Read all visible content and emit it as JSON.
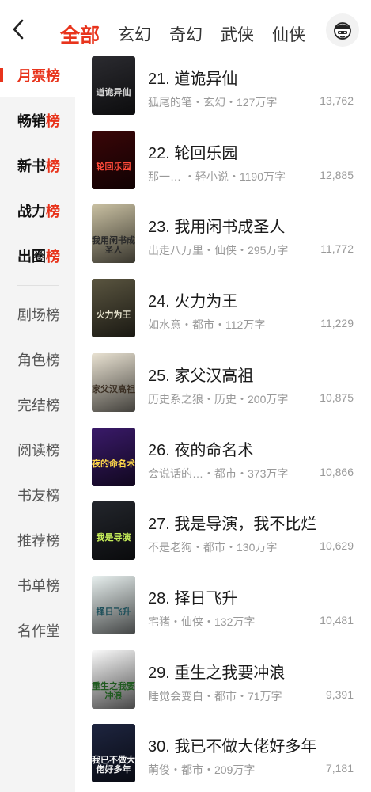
{
  "header": {
    "tabs": [
      "全部",
      "玄幻",
      "奇幻",
      "武侠",
      "仙侠"
    ],
    "active_tab": 0
  },
  "sidebar": {
    "items": [
      {
        "label_a": "月票",
        "label_b": "榜"
      },
      {
        "label_a": "畅销",
        "label_b": "榜"
      },
      {
        "label_a": "新书",
        "label_b": "榜"
      },
      {
        "label_a": "战力",
        "label_b": "榜"
      },
      {
        "label_a": "出圈",
        "label_b": "榜"
      },
      {
        "label_a": "剧场榜",
        "label_b": ""
      },
      {
        "label_a": "角色榜",
        "label_b": ""
      },
      {
        "label_a": "完结榜",
        "label_b": ""
      },
      {
        "label_a": "阅读榜",
        "label_b": ""
      },
      {
        "label_a": "书友榜",
        "label_b": ""
      },
      {
        "label_a": "推荐榜",
        "label_b": ""
      },
      {
        "label_a": "书单榜",
        "label_b": ""
      },
      {
        "label_a": "名作堂",
        "label_b": ""
      }
    ]
  },
  "books": [
    {
      "title": "21. 道诡异仙",
      "meta": "狐尾的笔・玄幻・127万字",
      "votes": "13,762",
      "cover_text": "道诡异仙",
      "cover_bg": "#2b2b30",
      "cover_fg": "#d8d8d8"
    },
    {
      "title": "22. 轮回乐园",
      "meta": "那一…   ・轻小说・1190万字",
      "votes": "12,885",
      "cover_text": "轮回乐园",
      "cover_bg": "#3a0608",
      "cover_fg": "#ff4a3a"
    },
    {
      "title": "23. 我用闲书成圣人",
      "meta": "出走八万里・仙侠・295万字",
      "votes": "11,772",
      "cover_text": "我用闲书成圣人",
      "cover_bg": "#c9c0a2",
      "cover_fg": "#2a2a2a"
    },
    {
      "title": "24. 火力为王",
      "meta": "如水意・都市・112万字",
      "votes": "11,229",
      "cover_text": "火力为王",
      "cover_bg": "#5a5540",
      "cover_fg": "#e8e4cf"
    },
    {
      "title": "25. 家父汉高祖",
      "meta": "历史系之狼・历史・200万字",
      "votes": "10,875",
      "cover_text": "家父汉高祖",
      "cover_bg": "#e9e2d2",
      "cover_fg": "#3a2e22"
    },
    {
      "title": "26. 夜的命名术",
      "meta": "会说话的…・都市・373万字",
      "votes": "10,866",
      "cover_text": "夜的命名术",
      "cover_bg": "#3a1a6a",
      "cover_fg": "#ffd84a"
    },
    {
      "title": "27. 我是导演，我不比烂",
      "meta": "不是老狗・都市・130万字",
      "votes": "10,629",
      "cover_text": "我是导演",
      "cover_bg": "#23262c",
      "cover_fg": "#c8f05a"
    },
    {
      "title": "28. 择日飞升",
      "meta": "宅猪・仙侠・132万字",
      "votes": "10,481",
      "cover_text": "择日飞升",
      "cover_bg": "#e8f0ef",
      "cover_fg": "#1d4f5a"
    },
    {
      "title": "29. 重生之我要冲浪",
      "meta": "睡觉会变白・都市・71万字",
      "votes": "9,391",
      "cover_text": "重生之我要冲浪",
      "cover_bg": "#fafafa",
      "cover_fg": "#1f5a1f"
    },
    {
      "title": "30. 我已不做大佬好多年",
      "meta": "萌俊・都市・209万字",
      "votes": "7,181",
      "cover_text": "我已不做大佬好多年",
      "cover_bg": "#1e2540",
      "cover_fg": "#f2f2f2"
    }
  ],
  "colors": {
    "accent": "#e8341c"
  }
}
